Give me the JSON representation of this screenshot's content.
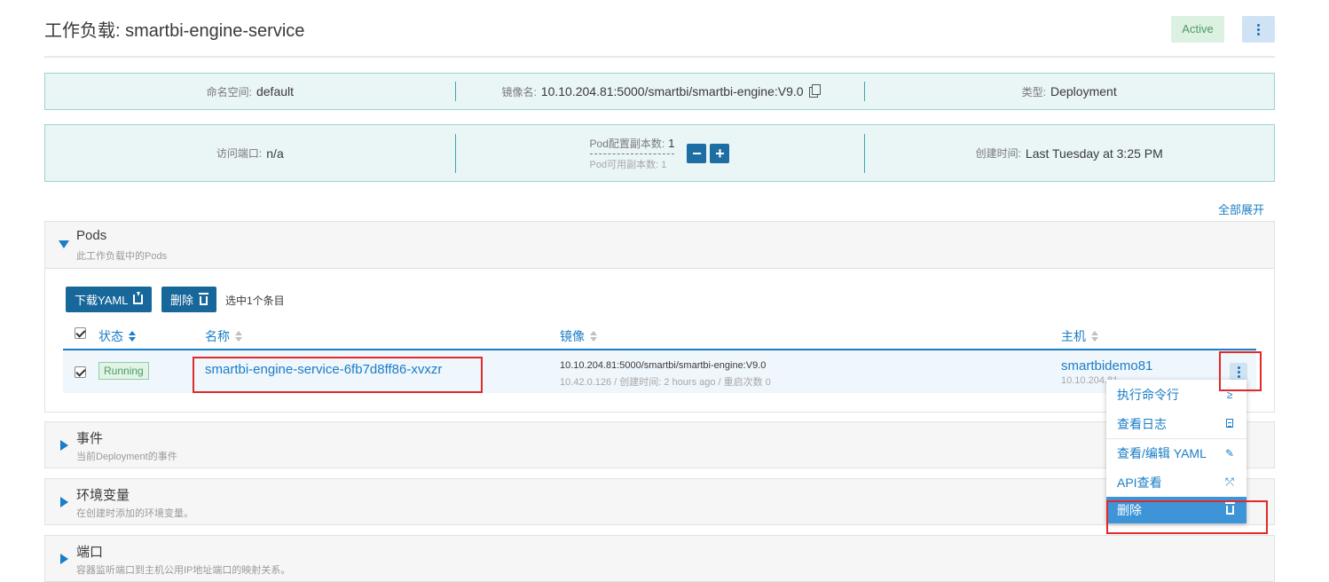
{
  "page": {
    "title": "工作负载: smartbi-engine-service",
    "state_badge": "Active"
  },
  "info": {
    "namespace_label": "命名空间:",
    "namespace_value": "default",
    "image_label": "镜像名:",
    "image_value": "10.10.204.81:5000/smartbi/smartbi-engine:V9.0",
    "type_label": "类型:",
    "type_value": "Deployment",
    "port_label": "访问端口:",
    "port_value": "n/a",
    "replicas_config_label": "Pod配置副本数:",
    "replicas_config_value": "1",
    "replicas_available_label": "Pod可用副本数:",
    "replicas_available_value": "1",
    "decrease_label": "−",
    "increase_label": "+",
    "created_label": "创建时间:",
    "created_value": "Last Tuesday at 3:25 PM"
  },
  "expand_all": "全部展开",
  "pods_section": {
    "title": "Pods",
    "subtitle": "此工作负载中的Pods",
    "download_yaml": "下载YAML",
    "delete": "删除",
    "selected_count": "选中1个条目",
    "columns": {
      "state": "状态",
      "name": "名称",
      "image": "镜像",
      "host": "主机"
    },
    "rows": [
      {
        "state": "Running",
        "name": "smartbi-engine-service-6fb7d8ff86-xvxzr",
        "image": "10.10.204.81:5000/smartbi/smartbi-engine:V9.0",
        "image_detail": "10.42.0.126 / 创建时间: 2 hours ago / 重启次数 0",
        "host": "smartbidemo81",
        "host_ip": "10.10.204.81"
      }
    ]
  },
  "action_menu": {
    "items": [
      {
        "label": "执行命令行",
        "icon": "≥"
      },
      {
        "label": "查看日志",
        "icon": ""
      },
      {
        "label": "查看/编辑 YAML",
        "icon": "✎"
      },
      {
        "label": "API查看",
        "icon": "⤱"
      },
      {
        "label": "删除",
        "icon": ""
      }
    ]
  },
  "sections": [
    {
      "title": "事件",
      "subtitle": "当前Deployment的事件"
    },
    {
      "title": "环境变量",
      "subtitle": "在创建时添加的环境变量。"
    },
    {
      "title": "端口",
      "subtitle": "容器监听端口到主机公用IP地址端口的映射关系。"
    }
  ],
  "colors": {
    "accent": "#1a7dc6",
    "info_bg": "#eaf5f6",
    "info_border": "#9bd3d6",
    "button_dark": "#18679a",
    "active_bg": "#dcf1e2",
    "running_green": "#4c9b62",
    "highlight_red": "#e02a2a",
    "menu_danger": "#3d95d8"
  }
}
